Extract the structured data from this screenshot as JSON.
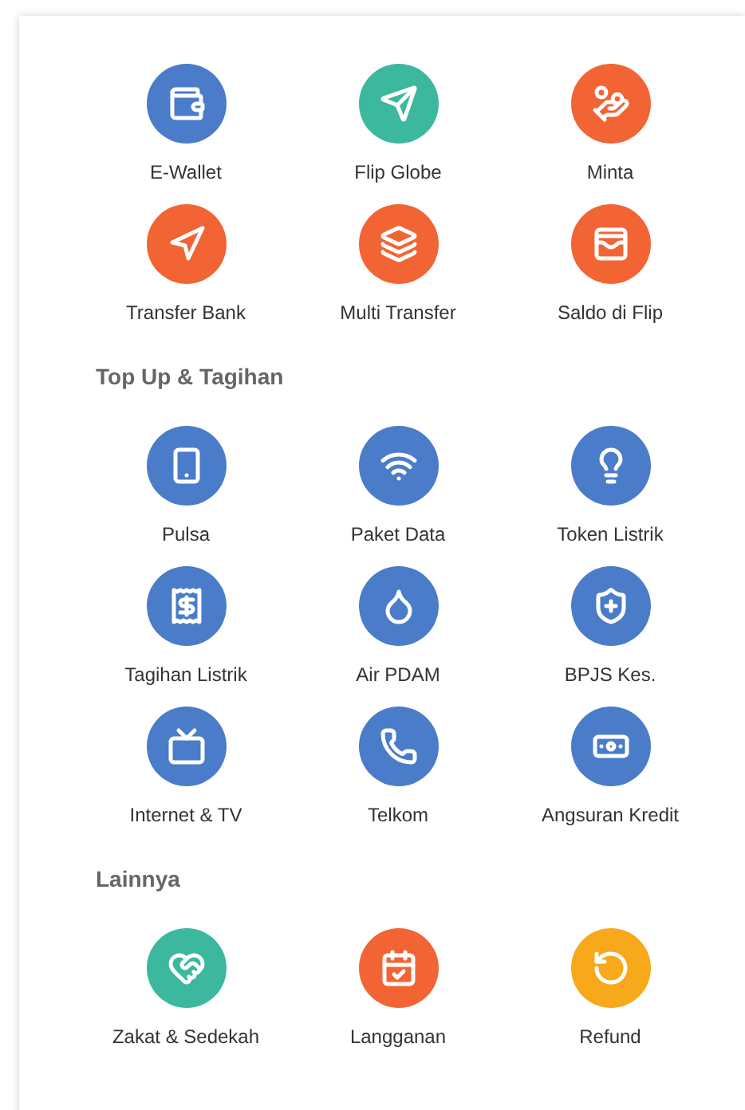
{
  "sections": [
    {
      "items": [
        {
          "label": "E-Wallet",
          "color": "#4a7cc9"
        },
        {
          "label": "Flip Globe",
          "color": "#3cb89f"
        },
        {
          "label": "Minta",
          "color": "#f26434"
        },
        {
          "label": "Transfer Bank",
          "color": "#f26434"
        },
        {
          "label": "Multi Transfer",
          "color": "#f26434"
        },
        {
          "label": "Saldo di Flip",
          "color": "#f26434"
        }
      ]
    },
    {
      "title": "Top Up & Tagihan",
      "items": [
        {
          "label": "Pulsa",
          "color": "#4a7cc9"
        },
        {
          "label": "Paket Data",
          "color": "#4a7cc9"
        },
        {
          "label": "Token Listrik",
          "color": "#4a7cc9"
        },
        {
          "label": "Tagihan Listrik",
          "color": "#4a7cc9"
        },
        {
          "label": "Air PDAM",
          "color": "#4a7cc9"
        },
        {
          "label": "BPJS Kes.",
          "color": "#4a7cc9"
        },
        {
          "label": "Internet & TV",
          "color": "#4a7cc9"
        },
        {
          "label": "Telkom",
          "color": "#4a7cc9"
        },
        {
          "label": "Angsuran Kredit",
          "color": "#4a7cc9"
        }
      ]
    },
    {
      "title": "Lainnya",
      "items": [
        {
          "label": "Zakat & Sedekah",
          "color": "#3cb89f"
        },
        {
          "label": "Langganan",
          "color": "#f26434"
        },
        {
          "label": "Refund",
          "color": "#f7a81b"
        }
      ]
    }
  ]
}
